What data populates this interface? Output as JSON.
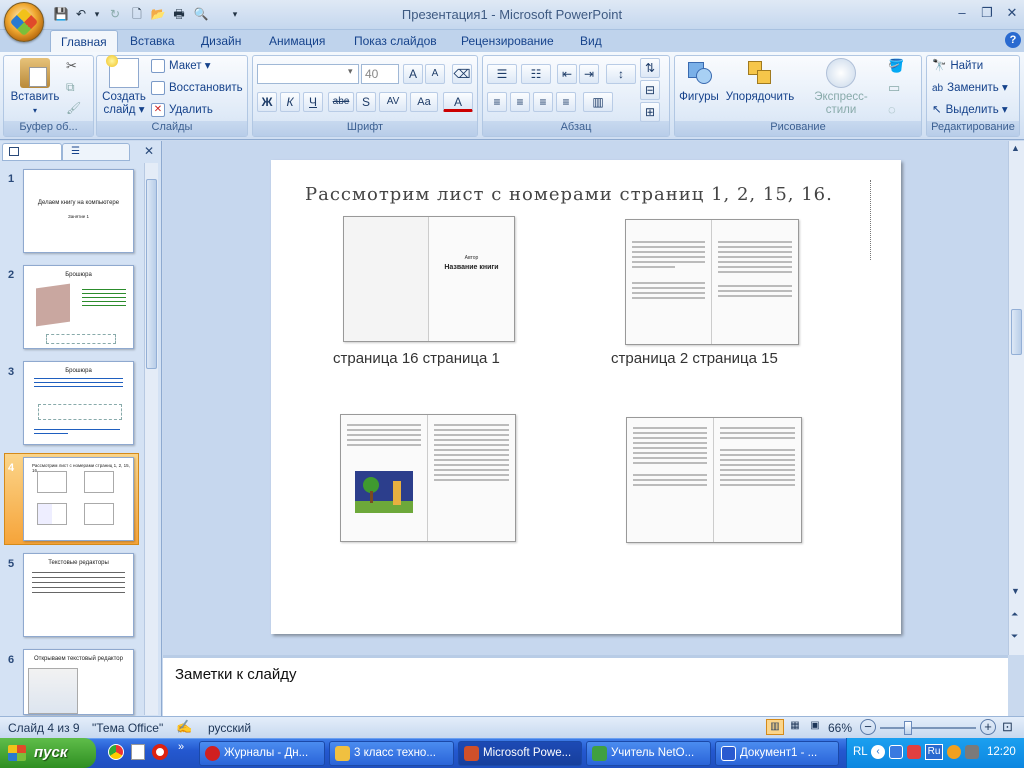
{
  "window": {
    "title": "Презентация1 - Microsoft PowerPoint",
    "controls": [
      "–",
      "❐",
      "✕"
    ]
  },
  "quick_access": [
    "save-icon",
    "undo-icon",
    "redo-icon",
    "new-icon",
    "open-icon",
    "print-icon",
    "preview-icon"
  ],
  "tabs": [
    {
      "label": "Главная",
      "active": true
    },
    {
      "label": "Вставка"
    },
    {
      "label": "Дизайн"
    },
    {
      "label": "Анимация"
    },
    {
      "label": "Показ слайдов"
    },
    {
      "label": "Рецензирование"
    },
    {
      "label": "Вид"
    }
  ],
  "ribbon": {
    "clipboard": {
      "label": "Буфер об...",
      "paste": "Вставить"
    },
    "slides": {
      "label": "Слайды",
      "create": "Создать",
      "create2": "слайд",
      "layout": "Макет",
      "reset": "Восстановить",
      "delete": "Удалить"
    },
    "font": {
      "label": "Шрифт",
      "font_name": "",
      "font_size": "40",
      "bold": "Ж",
      "italic": "К",
      "underline": "Ч",
      "strike": "abe",
      "shadow": "S",
      "spacing": "AV",
      "case": "Aa",
      "color": "A",
      "grow": "A",
      "shrink": "A"
    },
    "paragraph": {
      "label": "Абзац"
    },
    "drawing": {
      "label": "Рисование",
      "shapes": "Фигуры",
      "arrange": "Упорядочить",
      "quick_styles": "Экспресс-стили"
    },
    "editing": {
      "label": "Редактирование",
      "find": "Найти",
      "replace": "Заменить",
      "select": "Выделить"
    }
  },
  "slides_panel": {
    "thumbnails": [
      {
        "num": "1",
        "title": "Делаем книгу на компьютере",
        "sub": "Занятие 1"
      },
      {
        "num": "2",
        "title": "Брошюра"
      },
      {
        "num": "3",
        "title": "Брошюра"
      },
      {
        "num": "4",
        "title": "Рассмотрим лист с номерами страниц 1, 2, 15, 16."
      },
      {
        "num": "5",
        "title": "Текстовые редакторы"
      },
      {
        "num": "6",
        "title": "Открываем текстовый редактор"
      }
    ]
  },
  "slide": {
    "heading": "Рассмотрим лист с номерами страниц 1, 2, 15, 16.",
    "book_author": "Автор",
    "book_title": "Название книги",
    "caption_left": "страница  16  страница  1",
    "caption_right": "страница  2  страница  15"
  },
  "notes": {
    "placeholder": "Заметки к слайду"
  },
  "status": {
    "slide": "Слайд 4 из 9",
    "theme": "\"Тема Office\"",
    "language": "русский",
    "zoom": "66%"
  },
  "taskbar": {
    "start": "пуск",
    "items": [
      {
        "label": "Журналы - Дн...",
        "color": "#d02020"
      },
      {
        "label": "3 класс техно...",
        "color": "#f0c040"
      },
      {
        "label": "Microsoft Powe...",
        "color": "#d0502a",
        "active": true
      },
      {
        "label": "Учитель NetO...",
        "color": "#40a040"
      },
      {
        "label": "Документ1 - ...",
        "color": "#2a5ad0"
      }
    ],
    "tray_lang": "RL",
    "tray_ru": "Ru",
    "clock": "12:20"
  }
}
